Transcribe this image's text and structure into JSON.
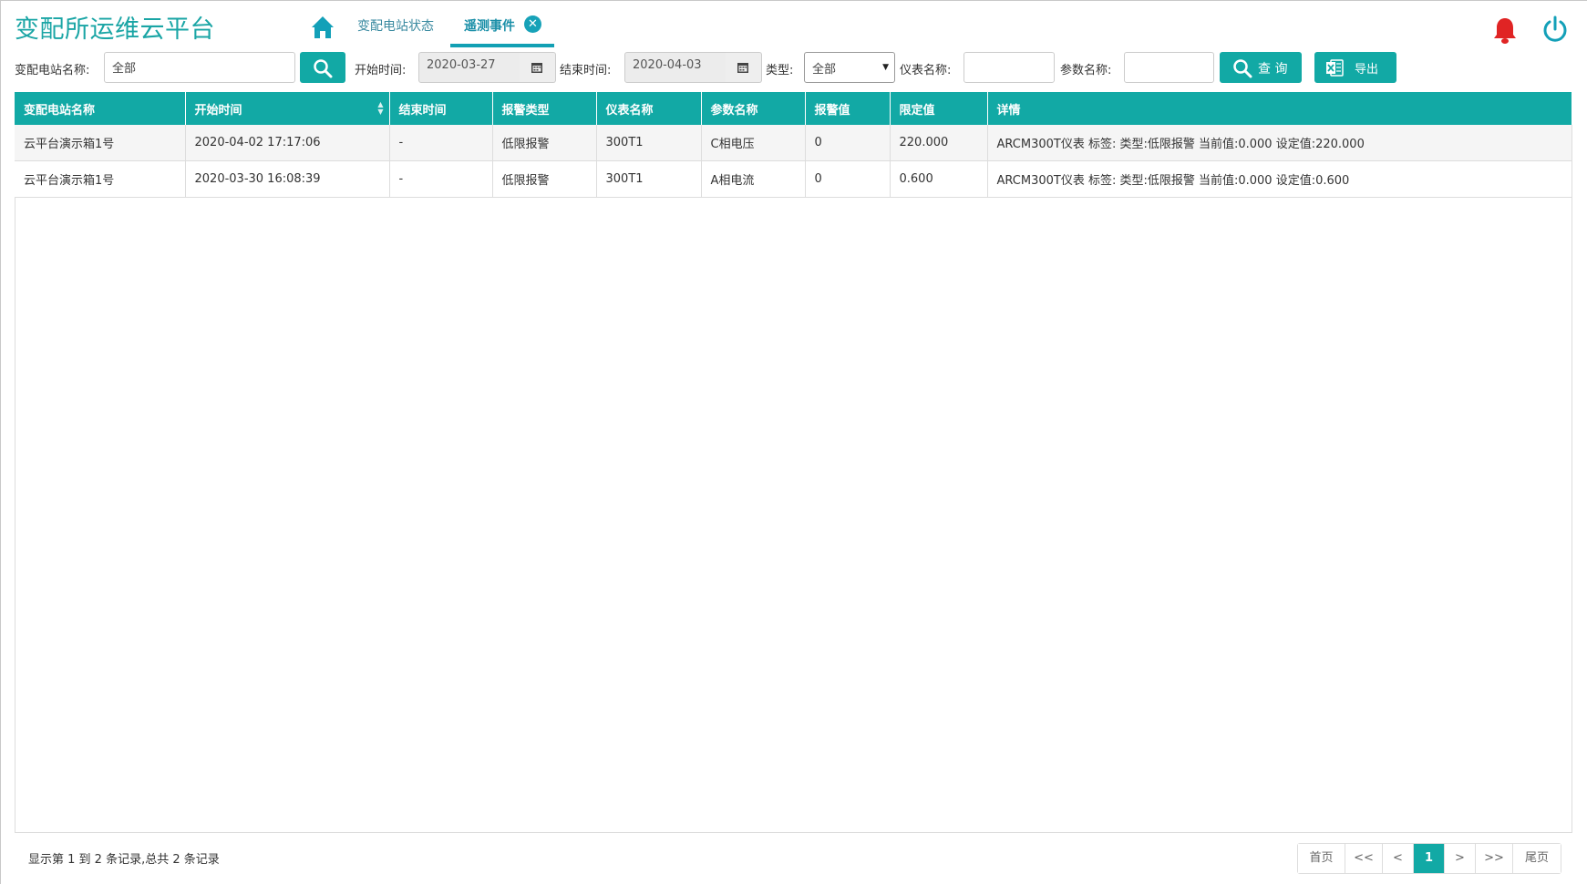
{
  "app": {
    "title": "变配所运维云平台"
  },
  "tabs": [
    {
      "label": "变配电站状态"
    },
    {
      "label": "遥测事件"
    }
  ],
  "filters": {
    "station_label": "变配电站名称:",
    "station_value": "全部",
    "start_label": "开始时间:",
    "start_value": "2020-03-27",
    "end_label": "结束时间:",
    "end_value": "2020-04-03",
    "type_label": "类型:",
    "type_value": "全部",
    "meter_label": "仪表名称:",
    "meter_value": "",
    "param_label": "参数名称:",
    "param_value": "",
    "query_label": "查 询",
    "export_label": "导出"
  },
  "table": {
    "columns": [
      "变配电站名称",
      "开始时间",
      "结束时间",
      "报警类型",
      "仪表名称",
      "参数名称",
      "报警值",
      "限定值",
      "详情"
    ],
    "rows": [
      [
        "云平台演示箱1号",
        "2020-04-02 17:17:06",
        "-",
        "低限报警",
        "300T1",
        "C相电压",
        "0",
        "220.000",
        "ARCM300T仪表 标签: 类型:低限报警 当前值:0.000 设定值:220.000"
      ],
      [
        "云平台演示箱1号",
        "2020-03-30 16:08:39",
        "-",
        "低限报警",
        "300T1",
        "A相电流",
        "0",
        "0.600",
        "ARCM300T仪表 标签: 类型:低限报警 当前值:0.000 设定值:0.600"
      ]
    ]
  },
  "footer": {
    "summary": "显示第 1 到 2 条记录,总共 2 条记录",
    "pager": [
      "首页",
      "<<",
      "<",
      "1",
      ">",
      ">>",
      "尾页"
    ],
    "current_page": "1"
  },
  "colors": {
    "accent": "#12a9a5",
    "title": "#1aa5a5",
    "bell": "#e02424"
  }
}
